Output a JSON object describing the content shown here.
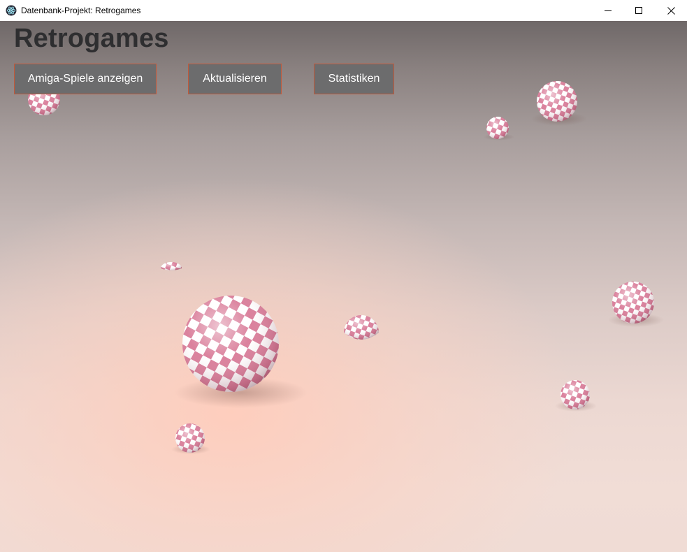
{
  "window": {
    "title": "Datenbank-Projekt: Retrogames",
    "app_icon": "electron-atom-icon",
    "controls": {
      "minimize_icon": "minimize-icon",
      "maximize_icon": "maximize-icon",
      "close_icon": "close-icon"
    }
  },
  "page": {
    "heading": "Retrogames"
  },
  "nav": {
    "buttons": [
      {
        "label": "Amiga-Spiele anzeigen"
      },
      {
        "label": "Aktualisieren"
      },
      {
        "label": "Statistiken"
      }
    ]
  },
  "background": {
    "description_icon": "checkered-spheres-background",
    "colors": {
      "sphere_pink": "#d4708f",
      "sphere_white": "#ffffff",
      "button_border": "#c2593a",
      "button_fill": "#6c6c6d",
      "heading": "#2e2e30"
    }
  }
}
